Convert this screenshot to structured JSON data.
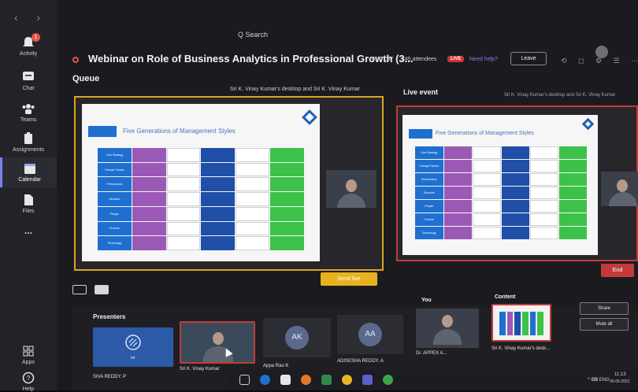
{
  "nav": {
    "arrows": "‹  ›"
  },
  "rail": {
    "items": [
      {
        "label": "Activity",
        "badge": "1"
      },
      {
        "label": "Chat"
      },
      {
        "label": "Teams"
      },
      {
        "label": "Assignments"
      },
      {
        "label": "Calendar"
      },
      {
        "label": "Files"
      },
      {
        "label": "..."
      }
    ],
    "apps_label": "Apps",
    "help_label": "Help"
  },
  "topbar": {
    "search_label": "Q  Search",
    "title": "Webinar on Role of Business Analytics in Professional Growth (3...",
    "timer": "01:07:47",
    "attendees": "245 attendees",
    "live_badge": "LIVE",
    "help_link": "Need help?",
    "leave_label": "Leave",
    "tool_icons": "⟲ ◻ ⚙ ☰ ⋯"
  },
  "queue": {
    "label": "Queue",
    "desc": "Sri K. Vinay Kumar's desktop and Sri K. Vinay Kumar",
    "slide_title": "Five Generations of Management Styles",
    "send_live": "Send live"
  },
  "live_event": {
    "label": "Live event",
    "desc": "Sri K. Vinay Kumar's desktop and Sri K. Vinay Kumar",
    "slide_title": "Five Generations of Management Styles",
    "end_label": "End"
  },
  "slide_rows": [
    "Core Strategy",
    "Change Factors",
    "Performance",
    "Structure",
    "People",
    "Process",
    "Technology"
  ],
  "presenters": {
    "label": "Presenters",
    "you_label": "You",
    "content_label": "Content",
    "tiles": [
      {
        "name": "SIVA REDDY. P",
        "sub": "bit"
      },
      {
        "name": "Sri K. Vinay Kumar"
      },
      {
        "name": "Appa Rao K",
        "initials": "AK"
      },
      {
        "name": "ADISESHA REDDY. A",
        "initials": "AA"
      },
      {
        "name": "Dr. APPEX A..."
      },
      {
        "name": "Sri K. Vinay Kumar's desk..."
      }
    ],
    "share_label": "Share",
    "mute_all_label": "Mute all"
  },
  "taskbar": {
    "time": "11:13",
    "date": "30-05-2021",
    "tray": "^ ⌨ ENG"
  },
  "colors": {
    "accent": "#7b83eb",
    "queue_border": "#d9a520",
    "live_border": "#c23b3b",
    "send_live": "#e8b21e"
  }
}
